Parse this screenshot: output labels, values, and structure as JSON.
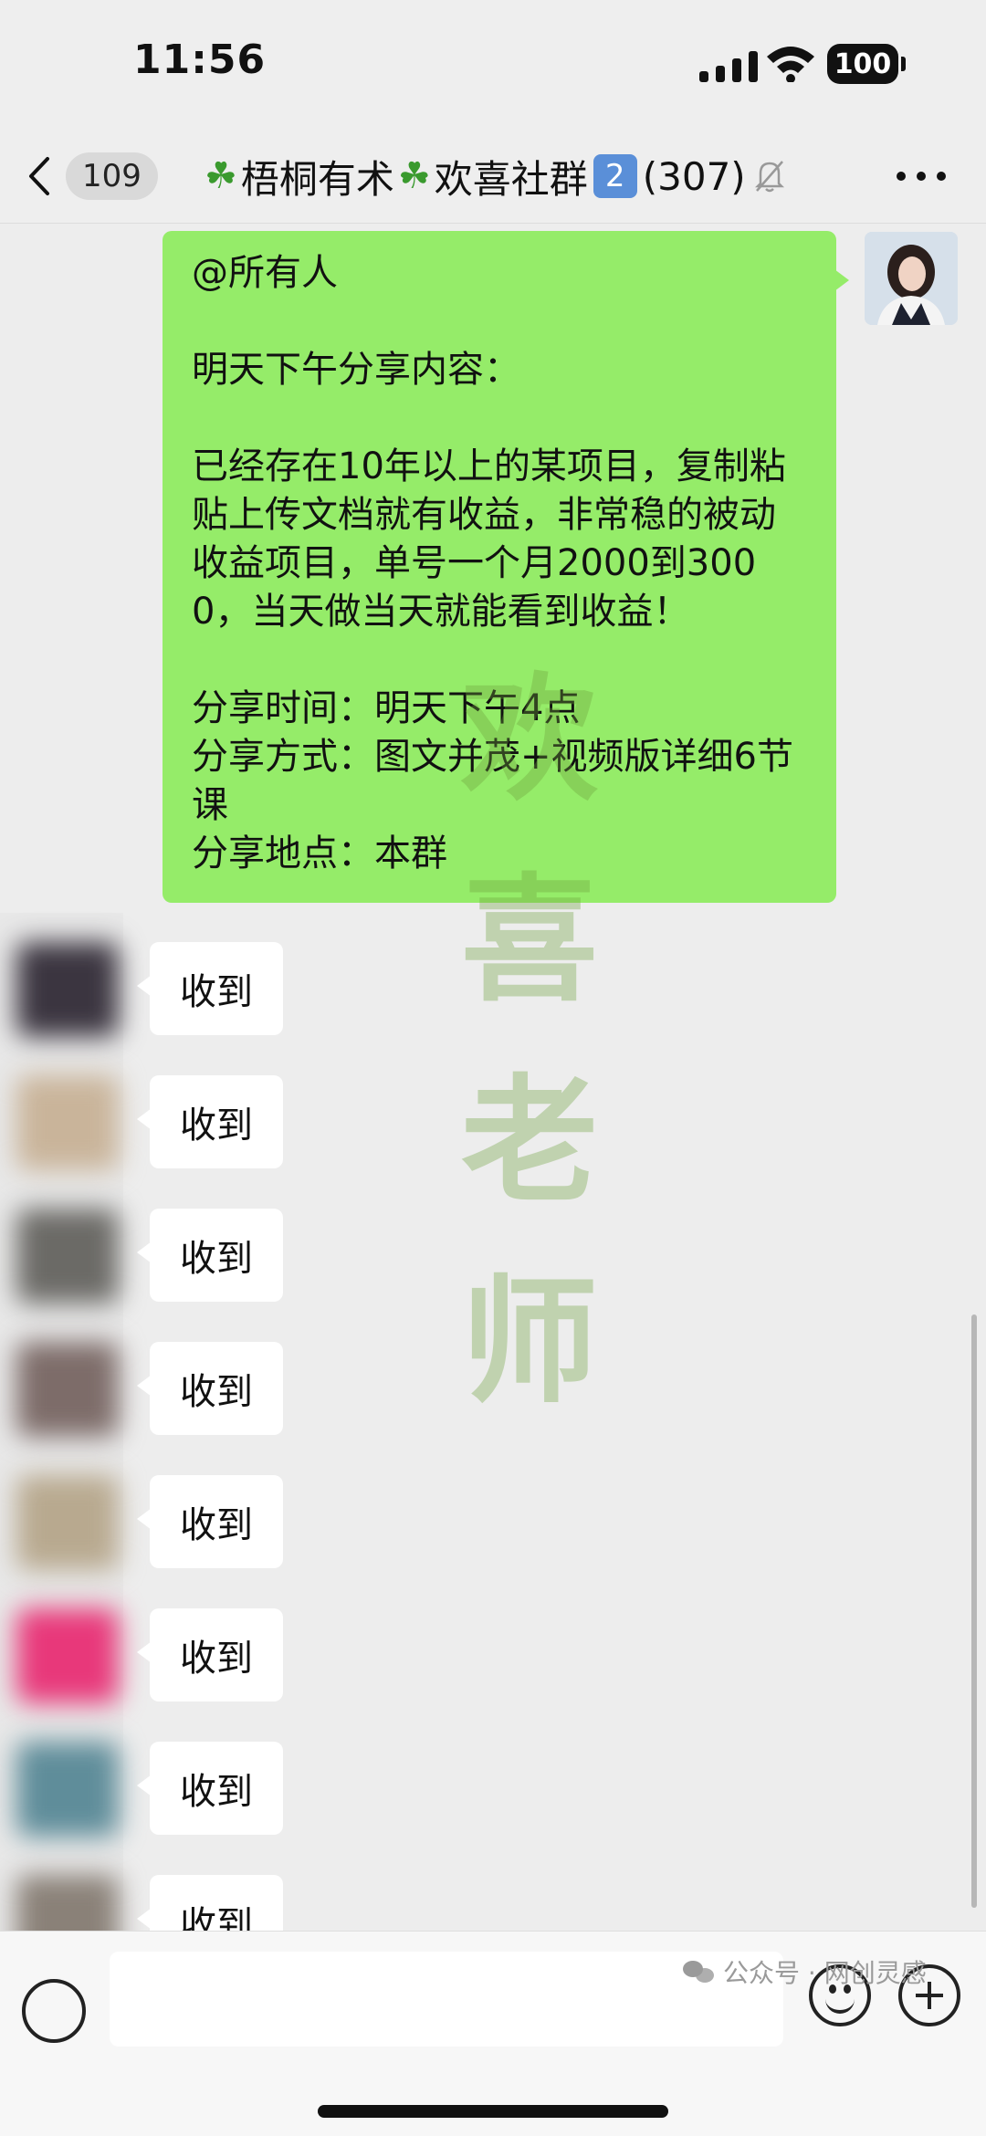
{
  "status_bar": {
    "time": "11:56",
    "battery": "100"
  },
  "nav": {
    "unread_count": "109",
    "title_part1": "梧桐有术",
    "title_part2": "欢喜社群",
    "title_num": "2",
    "member_count": "(307)"
  },
  "self_message": {
    "text": "@所有人\n\n明天下午分享内容：\n\n已经存在10年以上的某项目，复制粘贴上传文档就有收益，非常稳的被动收益项目，单号一个月2000到3000，当天做当天就能看到收益！\n\n分享时间：明天下午4点\n分享方式：图文并茂+视频版详细6节课\n分享地点：本群"
  },
  "watermark": {
    "lines": [
      "欢",
      "喜",
      "老",
      "师"
    ]
  },
  "replies": [
    {
      "text": "收到",
      "avatar_color": "#3b3540"
    },
    {
      "text": "收到",
      "avatar_color": "#c9b49a"
    },
    {
      "text": "收到",
      "avatar_color": "#6b6a66"
    },
    {
      "text": "收到",
      "avatar_color": "#7d6c69"
    },
    {
      "text": "收到",
      "avatar_color": "#b8a98f"
    },
    {
      "text": "收到",
      "avatar_color": "#e8387a"
    },
    {
      "text": "收到",
      "avatar_color": "#5f8d9a"
    },
    {
      "text": "收到",
      "avatar_color": "#8a8178"
    }
  ],
  "input": {
    "placeholder": ""
  },
  "source_note": {
    "text": "公众号 · 网创灵感"
  }
}
